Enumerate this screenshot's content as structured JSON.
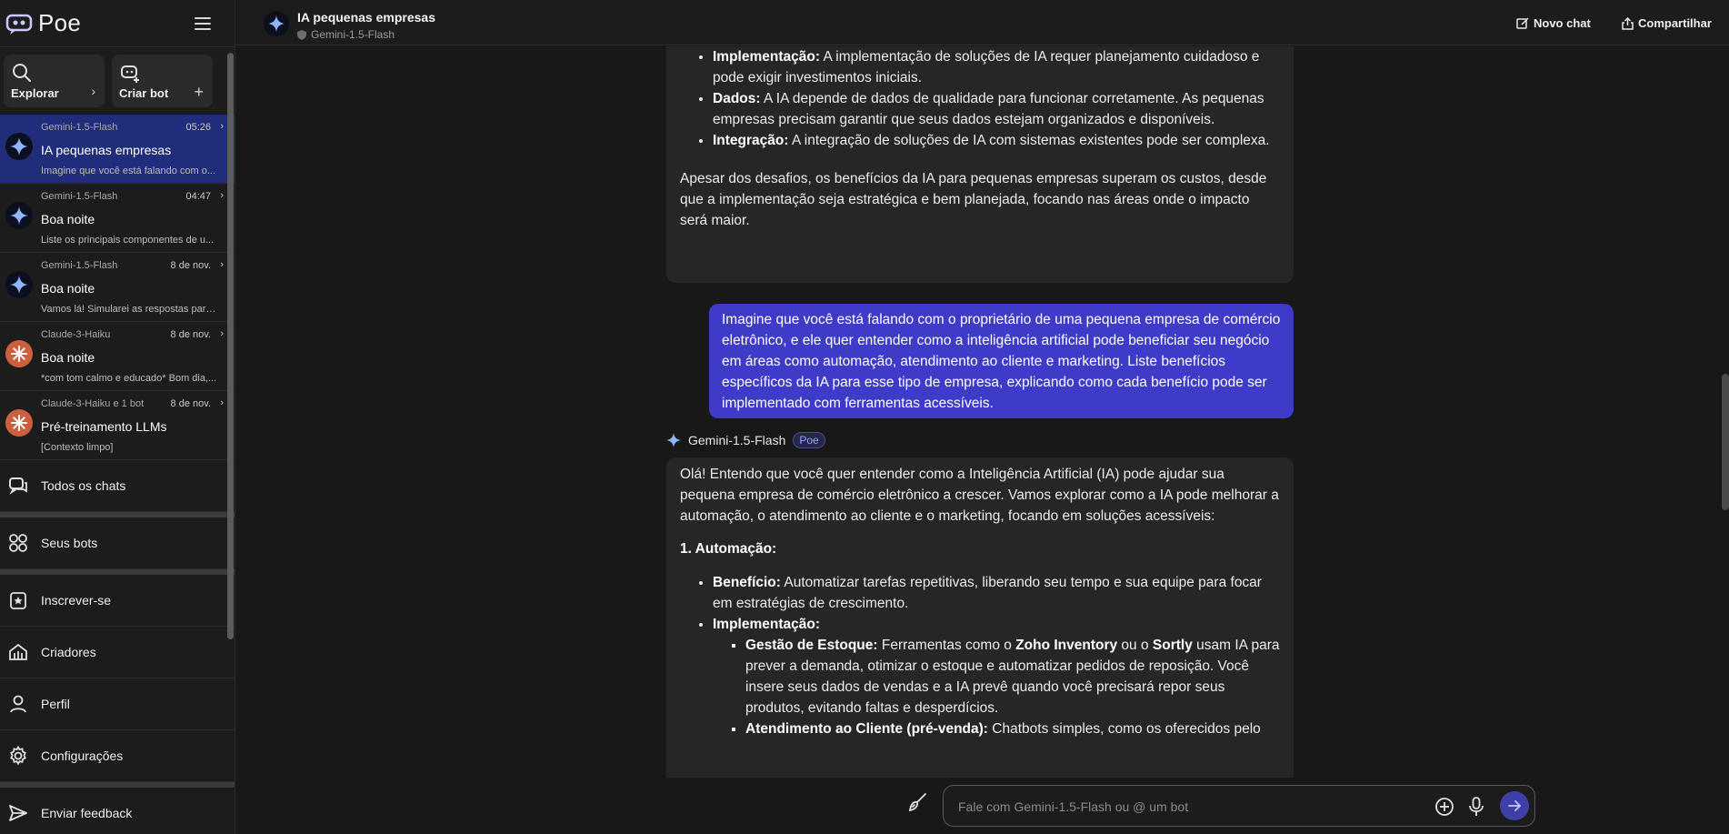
{
  "app": {
    "name": "Poe"
  },
  "sidebar": {
    "quick": [
      {
        "label": "Explorar",
        "icon": "search-icon"
      },
      {
        "label": "Criar bot",
        "icon": "create-bot-icon"
      }
    ],
    "chats": [
      {
        "bot": "Gemini-1.5-Flash",
        "time": "05:26",
        "title": "IA pequenas empresas",
        "preview": "Imagine que você está falando com o...",
        "avatar": "gemini"
      },
      {
        "bot": "Gemini-1.5-Flash",
        "time": "04:47",
        "title": "Boa noite",
        "preview": "Liste os principais componentes de u...",
        "avatar": "gemini"
      },
      {
        "bot": "Gemini-1.5-Flash",
        "time": "8 de nov.",
        "title": "Boa noite",
        "preview": "Vamos lá! Simularei as respostas para ...",
        "avatar": "gemini"
      },
      {
        "bot": "Claude-3-Haiku",
        "time": "8 de nov.",
        "title": "Boa noite",
        "preview": "*com tom calmo e educado* Bom dia,...",
        "avatar": "claude"
      },
      {
        "bot": "Claude-3-Haiku e 1 bot",
        "time": "8 de nov.",
        "title": "Pré-treinamento LLMs",
        "preview": "[Contexto limpo]",
        "avatar": "claude"
      }
    ],
    "nav": [
      {
        "label": "Todos os chats",
        "icon": "chats-icon"
      },
      {
        "label": "Seus bots",
        "icon": "bots-icon"
      },
      {
        "label": "Inscrever-se",
        "icon": "subscribe-icon"
      },
      {
        "label": "Criadores",
        "icon": "creators-icon"
      },
      {
        "label": "Perfil",
        "icon": "profile-icon"
      },
      {
        "label": "Configurações",
        "icon": "settings-icon"
      },
      {
        "label": "Enviar feedback",
        "icon": "send-feedback-icon"
      }
    ]
  },
  "header": {
    "title": "IA pequenas empresas",
    "subtitle": "Gemini-1.5-Flash",
    "new_chat": "Novo chat",
    "share": "Compartilhar"
  },
  "conversation": {
    "prev_bot": {
      "items": [
        {
          "bold": "Implementação:",
          "text": " A implementação de soluções de IA requer planejamento cuidadoso e pode exigir investimentos iniciais."
        },
        {
          "bold": "Dados:",
          "text": " A IA depende de dados de qualidade para funcionar corretamente. As pequenas empresas precisam garantir que seus dados estejam organizados e disponíveis."
        },
        {
          "bold": "Integração:",
          "text": " A integração de soluções de IA com sistemas existentes pode ser complexa."
        }
      ],
      "conclusion": "Apesar dos desafios, os benefícios da IA para pequenas empresas superam os custos, desde que a implementação seja estratégica e bem planejada, focando nas áreas onde o impacto será maior."
    },
    "user_message": "Imagine que você está falando com o proprietário de uma pequena empresa de comércio eletrônico, e ele quer entender como a inteligência artificial pode beneficiar seu negócio em áreas como automação, atendimento ao cliente e marketing. Liste benefícios específicos da IA para esse tipo de empresa, explicando como cada benefício pode ser implementado com ferramentas acessíveis.",
    "bot_name": "Gemini-1.5-Flash",
    "bot_badge": "Poe",
    "reply": {
      "intro": "Olá! Entendo que você quer entender como a Inteligência Artificial (IA) pode ajudar sua pequena empresa de comércio eletrônico a crescer. Vamos explorar como a IA pode melhorar a automação, o atendimento ao cliente e o marketing, focando em soluções acessíveis:",
      "section1": "1. Automação:",
      "benefit_bold": "Benefício:",
      "benefit_text": " Automatizar tarefas repetitivas, liberando seu tempo e sua equipe para focar em estratégias de crescimento.",
      "impl_bold": "Implementação:",
      "sub1_bold": "Gestão de Estoque:",
      "sub1_t1": " Ferramentas como o ",
      "sub1_b2": "Zoho Inventory",
      "sub1_t2": " ou o ",
      "sub1_b3": "Sortly",
      "sub1_t3": " usam IA para prever a demanda, otimizar o estoque e automatizar pedidos de reposição. Você insere seus dados de vendas e a IA prevê quando você precisará repor seus produtos, evitando faltas e desperdícios.",
      "sub2_bold": "Atendimento ao Cliente (pré-venda):",
      "sub2_text": " Chatbots simples, como os oferecidos pelo"
    }
  },
  "composer": {
    "placeholder": "Fale com Gemini-1.5-Flash ou @ um bot"
  },
  "colors": {
    "accent": "#3d3bc8",
    "active_chat": "#1f2d7a",
    "claude": "#cc5f3e"
  }
}
